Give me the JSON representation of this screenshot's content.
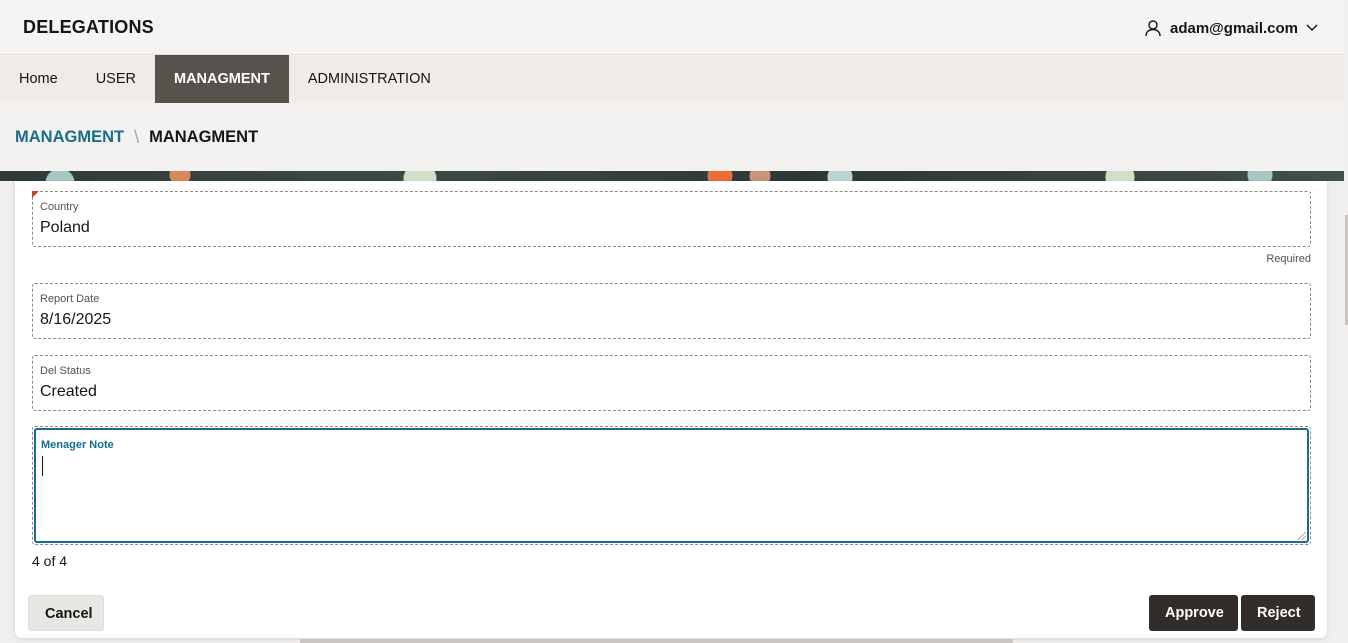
{
  "header": {
    "app_title": "DELEGATIONS",
    "user_email": "adam@gmail.com",
    "user_icon": "user-icon",
    "dropdown_icon": "chevron-down-icon"
  },
  "nav": {
    "tabs": [
      {
        "label": "Home",
        "active": false
      },
      {
        "label": "USER",
        "active": false
      },
      {
        "label": "MANAGMENT",
        "active": true
      },
      {
        "label": "ADMINISTRATION",
        "active": false
      }
    ]
  },
  "breadcrumb": {
    "parent": "MANAGMENT",
    "separator": "\\",
    "current": "MANAGMENT"
  },
  "form": {
    "country": {
      "label": "Country",
      "value": "Poland",
      "helper": "Required"
    },
    "report_date": {
      "label": "Report Date",
      "value": "8/16/2025"
    },
    "del_status": {
      "label": "Del Status",
      "value": "Created"
    },
    "manager_note": {
      "label": "Menager Note",
      "value": ""
    },
    "pager": "4 of 4"
  },
  "actions": {
    "cancel": "Cancel",
    "approve": "Approve",
    "reject": "Reject"
  },
  "colors": {
    "accent": "#1a6d8a",
    "active_tab": "#57524c",
    "primary_button": "#312d2a",
    "required_marker": "#c5441f"
  }
}
